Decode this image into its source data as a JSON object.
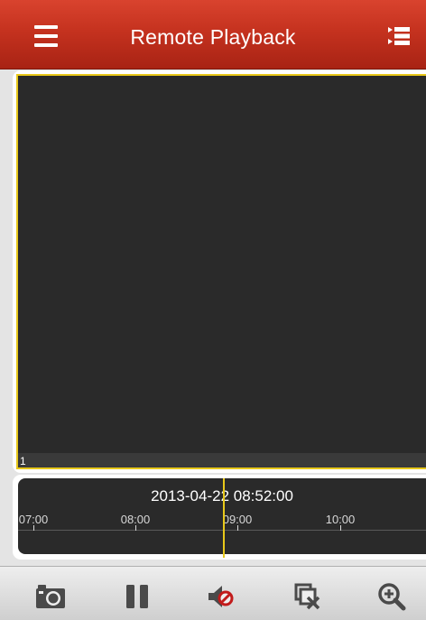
{
  "header": {
    "title": "Remote Playback",
    "menu_icon": "menu-icon",
    "list_icon": "channel-list-icon"
  },
  "video": {
    "window_index": "1"
  },
  "timeline": {
    "datetime": "2013-04-22 08:52:00",
    "ticks": [
      "07:00",
      "08:00",
      "09:00",
      "10:00"
    ]
  },
  "toolbar": {
    "icons": [
      "camera-icon",
      "pause-icon",
      "mute-icon",
      "close-window-icon",
      "zoom-in-icon"
    ]
  },
  "colors": {
    "header": "#c5321f",
    "selection": "#e8c81a",
    "pane": "#2a2a2a",
    "mute_accent": "#c21b1b"
  }
}
